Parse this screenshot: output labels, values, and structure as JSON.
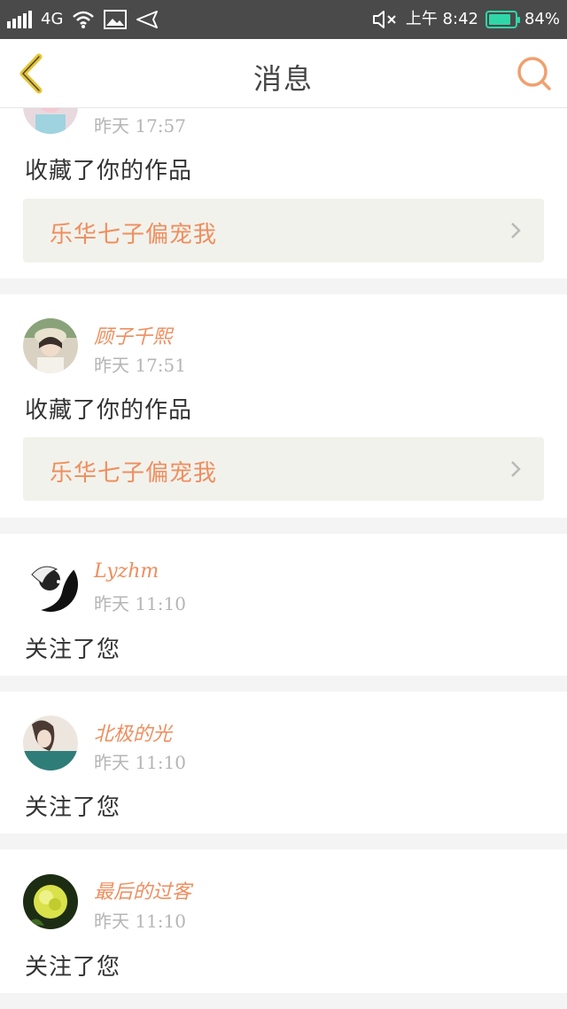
{
  "status_bar": {
    "network": "4G",
    "time": "上午 8:42",
    "battery": "84%",
    "battery_level": 0.84
  },
  "header": {
    "title": "消息"
  },
  "messages": [
    {
      "username": "",
      "time": "昨天 17:57",
      "action": "收藏了你的作品",
      "work_title": "乐华七子偏宠我"
    },
    {
      "username": "顾子千熙",
      "time": "昨天 17:51",
      "action": "收藏了你的作品",
      "work_title": "乐华七子偏宠我"
    },
    {
      "username": "Lyzhm",
      "time": "昨天 11:10",
      "action": "关注了您"
    },
    {
      "username": "北极的光",
      "time": "昨天 11:10",
      "action": "关注了您"
    },
    {
      "username": "最后的过客",
      "time": "昨天 11:10",
      "action": "关注了您"
    }
  ],
  "icons": {
    "back": "chevron-left-icon",
    "search": "search-icon",
    "open_work": "chevron-right-icon"
  },
  "colors": {
    "accent": "#ef8e5e",
    "back_icon": "#e6c431",
    "status_bar": "#4a4a4a",
    "battery": "#2fd6a8"
  }
}
